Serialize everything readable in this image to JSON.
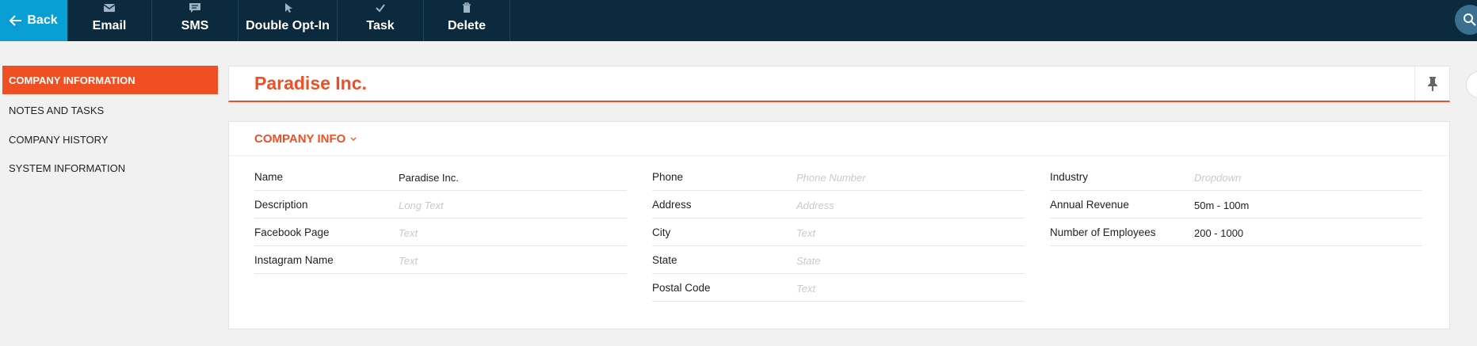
{
  "toolbar": {
    "back": "Back",
    "email": "Email",
    "sms": "SMS",
    "double_opt_in": "Double Opt-In",
    "task": "Task",
    "delete": "Delete"
  },
  "sidebar": {
    "items": [
      {
        "label": "COMPANY INFORMATION"
      },
      {
        "label": "NOTES AND TASKS"
      },
      {
        "label": "COMPANY HISTORY"
      },
      {
        "label": "SYSTEM INFORMATION"
      }
    ]
  },
  "header": {
    "title": "Paradise Inc."
  },
  "section": {
    "title": "COMPANY INFO",
    "columns": [
      [
        {
          "label": "Name",
          "value": "Paradise Inc."
        },
        {
          "label": "Description",
          "placeholder": "Long Text"
        },
        {
          "label": "Facebook Page",
          "placeholder": "Text"
        },
        {
          "label": "Instagram Name",
          "placeholder": "Text"
        }
      ],
      [
        {
          "label": "Phone",
          "placeholder": "Phone Number"
        },
        {
          "label": "Address",
          "placeholder": "Address"
        },
        {
          "label": "City",
          "placeholder": "Text"
        },
        {
          "label": "State",
          "placeholder": "State"
        },
        {
          "label": "Postal Code",
          "placeholder": "Text"
        }
      ],
      [
        {
          "label": "Industry",
          "placeholder": "Dropdown"
        },
        {
          "label": "Annual Revenue",
          "value": "50m - 100m"
        },
        {
          "label": "Number of Employees",
          "value": "200 - 1000"
        }
      ]
    ]
  },
  "colors": {
    "accent": "#f04f23",
    "topbar": "#0b2a3e",
    "back": "#0a9fd4",
    "placeholder": "#c9c9c9"
  },
  "icons": [
    "back-arrow-icon",
    "envelope-icon",
    "chat-bubble-icon",
    "cursor-icon",
    "checkmark-icon",
    "trash-icon",
    "search-icon",
    "pin-icon",
    "chevron-down-icon"
  ]
}
